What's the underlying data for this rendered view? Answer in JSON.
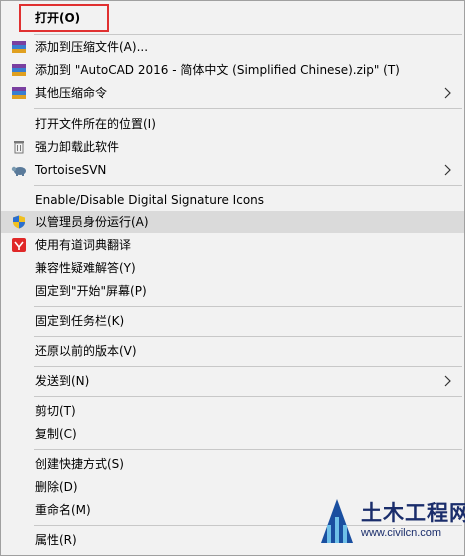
{
  "menu": {
    "open": "打开(O)",
    "add_to_archive": "添加到压缩文件(A)...",
    "add_to_zip": "添加到 \"AutoCAD 2016 - 简体中文 (Simplified Chinese).zip\" (T)",
    "other_compress": "其他压缩命令",
    "open_location": "打开文件所在的位置(I)",
    "force_uninstall": "强力卸载此软件",
    "tortoise": "TortoiseSVN",
    "signature_icons": "Enable/Disable Digital Signature Icons",
    "run_as_admin": "以管理员身份运行(A)",
    "youdao": "使用有道词典翻译",
    "compat": "兼容性疑难解答(Y)",
    "pin_start": "固定到\"开始\"屏幕(P)",
    "pin_taskbar": "固定到任务栏(K)",
    "restore": "还原以前的版本(V)",
    "send_to": "发送到(N)",
    "cut": "剪切(T)",
    "copy": "复制(C)",
    "create_shortcut": "创建快捷方式(S)",
    "delete": "删除(D)",
    "rename": "重命名(M)",
    "properties": "属性(R)"
  },
  "watermark": {
    "title": "土木工程网",
    "url": "www.civilcn.com"
  },
  "colors": {
    "highlight": "#dadada",
    "red_box": "#e03030",
    "separator": "#c8c8c8"
  }
}
